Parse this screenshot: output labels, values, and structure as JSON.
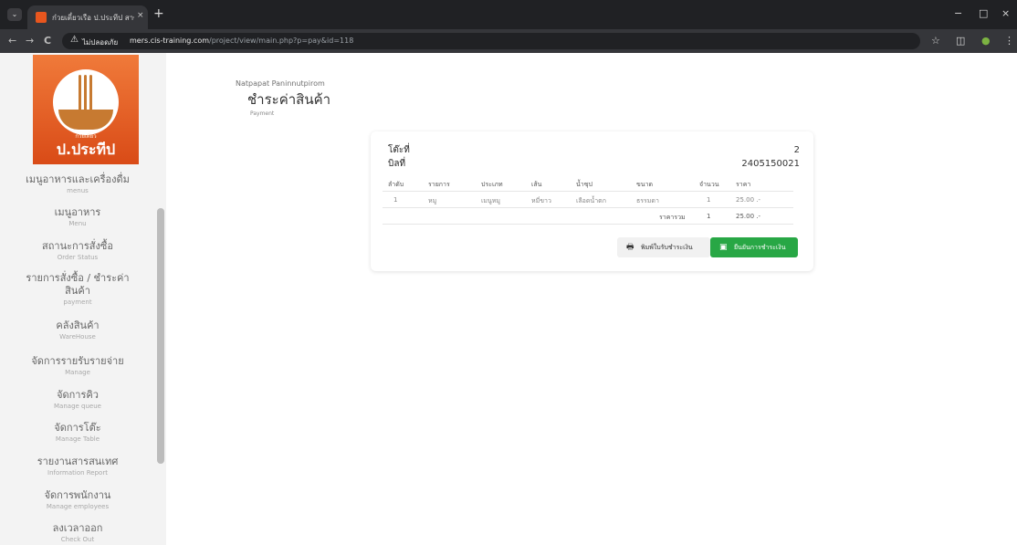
{
  "browser": {
    "tab_title": "ก๋วยเตี๋ยวเรือ ป.ประทีป สาขาเมืองเยย",
    "tab_close": "×",
    "new_tab": "+",
    "menu_chevron": "⌄",
    "security_label": "ไม่ปลอดภัย",
    "url_host": "mers.cis-training.com",
    "url_path": "/project/view/main.php?p=pay&id=118",
    "window_controls": {
      "minimize": "−",
      "restore": "□",
      "close": "×"
    },
    "nav": {
      "back": "←",
      "forward": "→",
      "reload": "C"
    }
  },
  "sidebar": {
    "logo_small": "ก๋วยเตี๋ยว",
    "logo_text": "ป.ประทีป",
    "items": [
      {
        "th": "เมนูอาหารและเครื่องดื่ม",
        "en": "menus"
      },
      {
        "th": "เมนูอาหาร",
        "en": "Menu"
      },
      {
        "th": "สถานะการสั่งซื้อ",
        "en": "Order Status"
      },
      {
        "th": "รายการสั่งซื้อ / ชำระค่าสินค้า",
        "en": "payment"
      },
      {
        "th": "คลังสินค้า",
        "en": "WareHouse"
      },
      {
        "th": "จัดการรายรับรายจ่าย",
        "en": "Manage"
      },
      {
        "th": "จัดการคิว",
        "en": "Manage queue"
      },
      {
        "th": "จัดการโต๊ะ",
        "en": "Manage Table"
      },
      {
        "th": "รายงานสารสนเทศ",
        "en": "Information Report"
      },
      {
        "th": "จัดการพนักงาน",
        "en": "Manage employees"
      },
      {
        "th": "ลงเวลาออก",
        "en": "Check Out"
      }
    ]
  },
  "main": {
    "user_name": "Natpapat Paninnutpirom",
    "title": "ชำระค่าสินค้า",
    "subtitle": "Payment",
    "card": {
      "table_label": "โต๊ะที่",
      "table_value": "2",
      "bill_label": "บิลที่",
      "bill_value": "2405150021",
      "headers": [
        "ลำดับ",
        "รายการ",
        "ประเภท",
        "เส้น",
        "น้ำซุป",
        "ขนาด",
        "จำนวน",
        "ราคา"
      ],
      "rows": [
        [
          "1",
          "หมู",
          "เมนูหมู",
          "หมี่ขาว",
          "เลือดน้ำตก",
          "ธรรมดา",
          "1",
          "25.00 .-"
        ]
      ],
      "total_label": "ราคารวม",
      "total_qty": "1",
      "total_price": "25.00 .-",
      "print_label": "พิมพ์ใบรับชำระเงิน",
      "confirm_label": "ยืนยันการชำระเงิน"
    }
  },
  "colors": {
    "brand_orange": "#e8561e",
    "confirm_green": "#28a745"
  },
  "icons": [
    "chevron-down-icon",
    "favicon-icon",
    "back-arrow-icon",
    "forward-arrow-icon",
    "reload-icon",
    "warning-icon",
    "star-icon",
    "extensions-icon",
    "profile-icon",
    "more-icon",
    "printer-icon",
    "cash-icon"
  ]
}
